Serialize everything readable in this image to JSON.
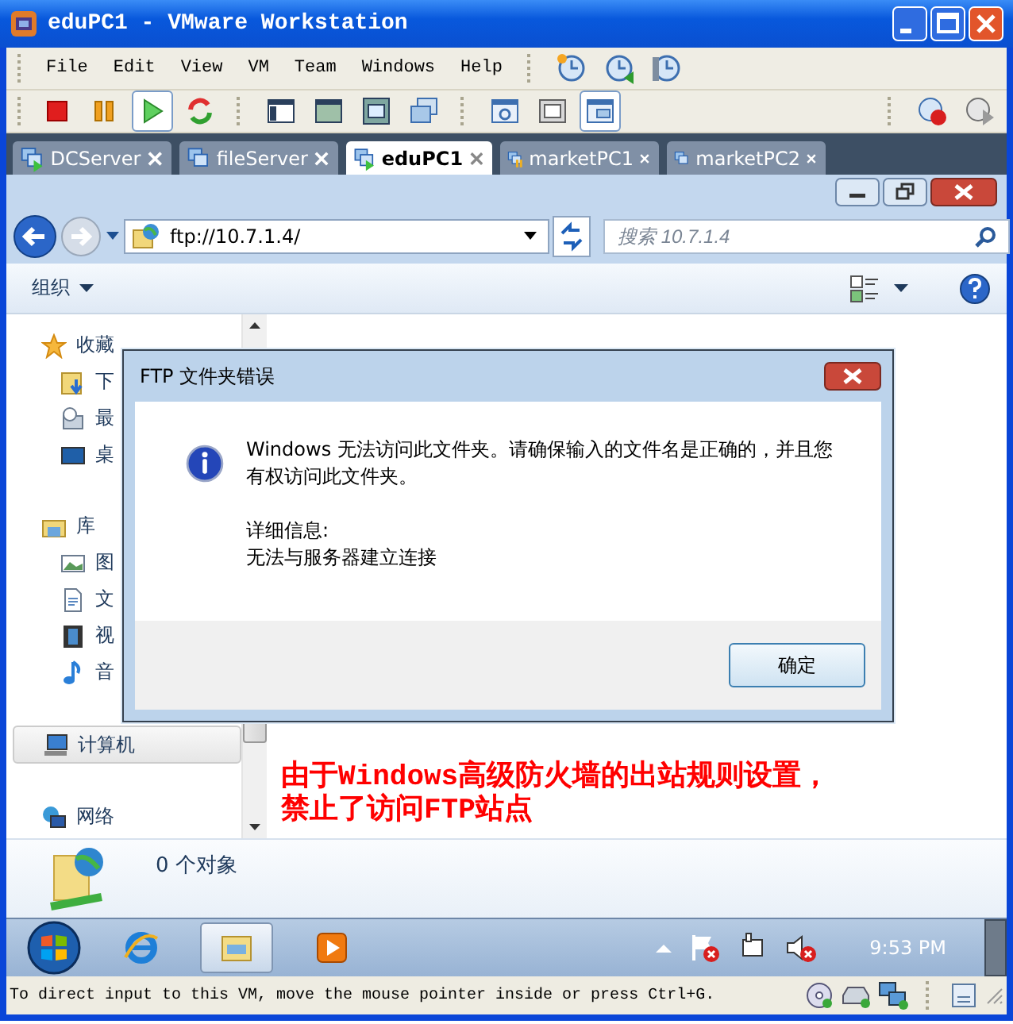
{
  "window": {
    "title": "eduPC1 - VMware Workstation"
  },
  "menus": [
    "File",
    "Edit",
    "View",
    "VM",
    "Team",
    "Windows",
    "Help"
  ],
  "toolbar": [
    {
      "kind": "stop",
      "pressed": false
    },
    {
      "kind": "pause",
      "pressed": false
    },
    {
      "kind": "play",
      "pressed": true
    },
    {
      "kind": "reset",
      "pressed": false
    },
    {
      "kind": "sidebar",
      "pressed": false
    },
    {
      "kind": "fullscreen",
      "pressed": false
    },
    {
      "kind": "fit",
      "pressed": false
    },
    {
      "kind": "windows",
      "pressed": false
    },
    {
      "kind": "settings",
      "pressed": false
    },
    {
      "kind": "screen",
      "pressed": false
    },
    {
      "kind": "console",
      "pressed": true
    }
  ],
  "tabs": [
    {
      "label": "DCServer",
      "running": true,
      "suspended": false,
      "selected": false
    },
    {
      "label": "fileServer",
      "running": false,
      "suspended": false,
      "selected": false
    },
    {
      "label": "eduPC1",
      "running": true,
      "suspended": false,
      "selected": true
    },
    {
      "label": "marketPC1",
      "running": false,
      "suspended": true,
      "selected": false
    },
    {
      "label": "marketPC2",
      "running": false,
      "suspended": false,
      "selected": false
    }
  ],
  "explorer": {
    "address": "ftp://10.7.1.4/",
    "search": {
      "placeholder": "搜索 10.7.1.4"
    },
    "organize": "组织",
    "nav": [
      {
        "kind": "favorites",
        "label": "收藏",
        "selected": false,
        "children": [
          {
            "kind": "downloads",
            "label": "下",
            "selected": false
          },
          {
            "kind": "recent",
            "label": "最",
            "selected": false
          },
          {
            "kind": "desktop",
            "label": "桌",
            "selected": false
          }
        ]
      },
      {
        "kind": "libraries",
        "label": "库",
        "selected": false,
        "children": [
          {
            "kind": "pictures",
            "label": "图",
            "selected": false
          },
          {
            "kind": "documents",
            "label": "文",
            "selected": false
          },
          {
            "kind": "videos",
            "label": "视",
            "selected": false
          },
          {
            "kind": "music",
            "label": "音",
            "selected": false
          }
        ]
      },
      {
        "kind": "computer",
        "label": "计算机",
        "selected": true
      },
      {
        "kind": "network",
        "label": "网络",
        "selected": false
      }
    ],
    "annotation": [
      "由于Windows高级防火墙的出站规则设置，",
      "禁止了访问FTP站点"
    ],
    "status": "0 个对象"
  },
  "dialog": {
    "title": "FTP 文件夹错误",
    "message": "Windows 无法访问此文件夹。请确保输入的文件名是正确的，并且您有权访问此文件夹。",
    "details_label": "详细信息:",
    "details": "无法与服务器建立连接",
    "button": "确定"
  },
  "taskbar": {
    "apps": [
      {
        "kind": "browser",
        "active": false
      },
      {
        "kind": "folder",
        "active": true
      },
      {
        "kind": "media",
        "active": false
      }
    ],
    "clock": "9:53 PM"
  },
  "status_bar": "To direct input to this VM, move the mouse pointer inside or press Ctrl+G."
}
